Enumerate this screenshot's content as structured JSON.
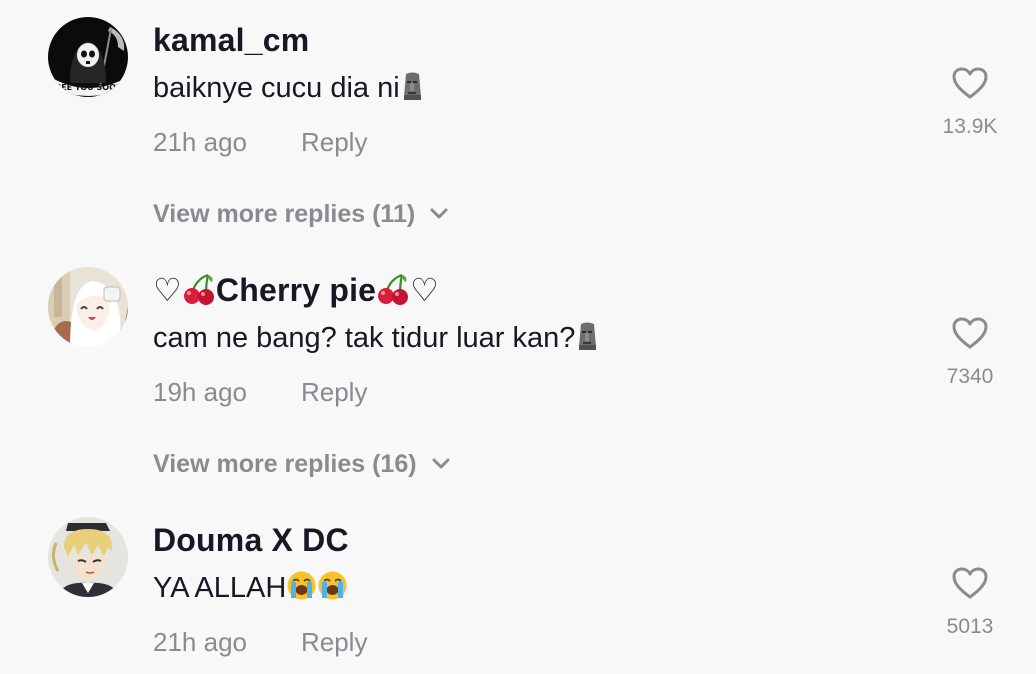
{
  "comments": [
    {
      "username": "kamal_cm",
      "avatar_icon": "grim-reaper-avatar",
      "avatar_text": "SEE YOU SOON",
      "text": "baiknye cucu dia ni",
      "emoji_suffix": "moai",
      "time": "21h ago",
      "reply_label": "Reply",
      "likes": "13.9K",
      "more_replies": "View more replies (11)"
    },
    {
      "username_prefix": "♡",
      "username": "Cherry pie",
      "username_suffix": "♡",
      "username_emoji": "cherries",
      "avatar_icon": "anime-girl-avatar",
      "text": "cam ne bang? tak tidur luar kan?",
      "emoji_suffix": "moai",
      "time": "19h ago",
      "reply_label": "Reply",
      "likes": "7340",
      "more_replies": "View more replies (16)"
    },
    {
      "username": "Douma X DC",
      "avatar_icon": "anime-boy-avatar",
      "text": "YA ALLAH",
      "emoji_suffix": "loudly-crying-face x2",
      "time": "21h ago",
      "reply_label": "Reply",
      "likes": "5013"
    }
  ],
  "colors": {
    "background": "#f8f8f8",
    "primary_text": "#161823",
    "secondary_text": "#8a8b91",
    "cherry_red": "#d81e3c"
  }
}
